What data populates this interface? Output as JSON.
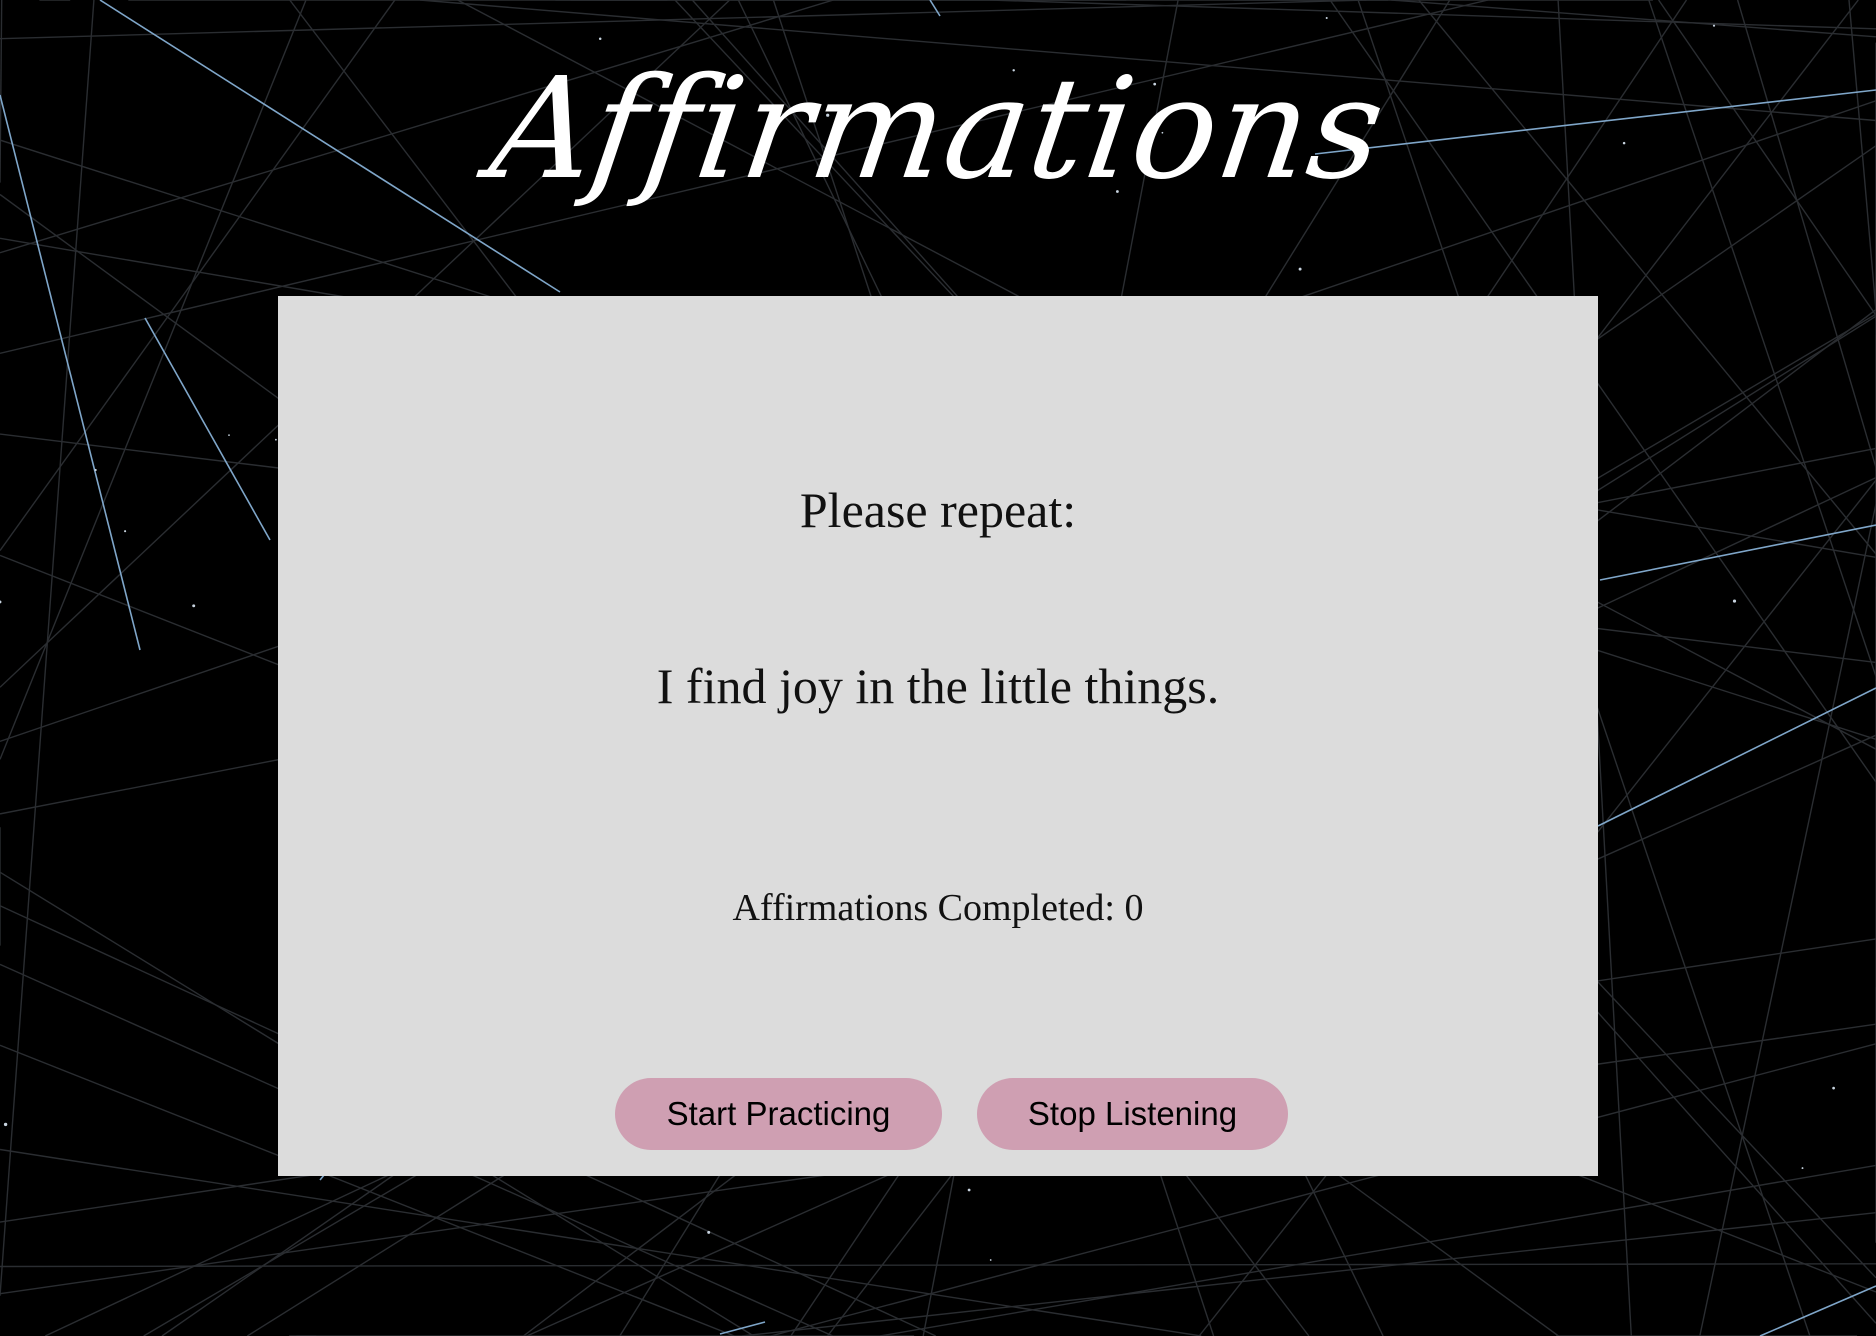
{
  "page": {
    "title": "Affirmations",
    "background_color": "#000000",
    "line_color": "#7fa6c9",
    "card_color": "#dcdcdc"
  },
  "practice": {
    "prompt": "Please repeat:",
    "affirmation": "I find joy in the little things.",
    "completed_label": "Affirmations Completed: ",
    "completed_count": "0"
  },
  "buttons": {
    "start_label": "Start Practicing",
    "stop_label": "Stop Listening",
    "color": "#cf9fb2"
  }
}
